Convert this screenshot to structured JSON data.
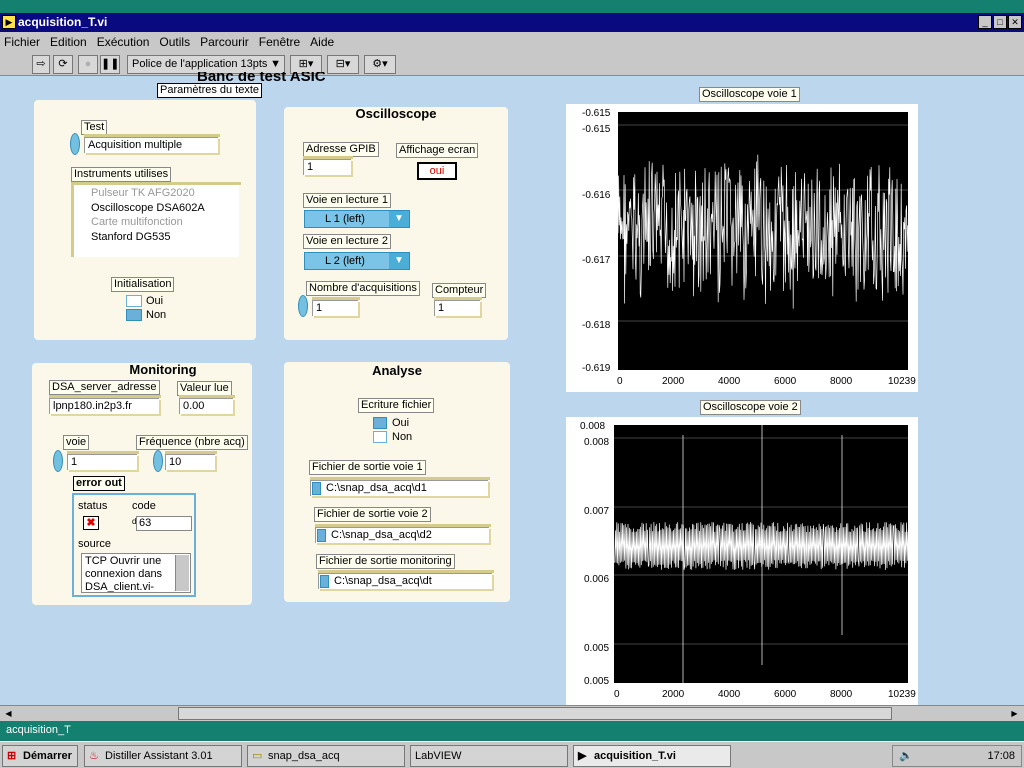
{
  "window": {
    "title": "acquisition_T.vi"
  },
  "menu": [
    "Fichier",
    "Edition",
    "Exécution",
    "Outils",
    "Parcourir",
    "Fenêtre",
    "Aide"
  ],
  "toolbar": {
    "font_label": "Police de l'application 13pts"
  },
  "header": {
    "overlap_title": "Banc de test ASIC",
    "font_tooltip": "Paramètres du texte"
  },
  "test_panel": {
    "test_label": "Test",
    "test_value": "Acquisition multiple",
    "instruments_label": "Instruments utilises",
    "instruments": [
      "Pulseur TK AFG2020",
      "Oscilloscope DSA602A",
      "Carte multifonction",
      "Stanford DG535"
    ],
    "init_label": "Initialisation",
    "init_oui": "Oui",
    "init_non": "Non"
  },
  "oscillo_panel": {
    "title": "Oscilloscope",
    "gpib_label": "Adresse GPIB",
    "gpib_value": "1",
    "affichage_label": "Affichage ecran",
    "affichage_value": "oui",
    "voie1_label": "Voie en lecture 1",
    "voie1_value": "L 1 (left)",
    "voie2_label": "Voie en lecture 2",
    "voie2_value": "L 2 (left)",
    "nb_acq_label": "Nombre d'acquisitions",
    "nb_acq_value": "1",
    "compteur_label": "Compteur",
    "compteur_value": "1"
  },
  "monitoring_panel": {
    "title": "Monitoring",
    "server_label": "DSA_server_adresse",
    "server_value": "lpnp180.in2p3.fr",
    "valeur_label": "Valeur lue",
    "valeur_value": "0.00",
    "voie_label": "voie",
    "voie_value": "1",
    "freq_label": "Fréquence (nbre acq)",
    "freq_value": "10",
    "error_label": "error out",
    "status_label": "status",
    "code_label": "code",
    "code_value": "63",
    "source_label": "source",
    "source_value": "TCP Ouvrir une connexion dans DSA_client.vi-"
  },
  "analyse_panel": {
    "title": "Analyse",
    "ecriture_label": "Ecriture fichier",
    "ecriture_oui": "Oui",
    "ecriture_non": "Non",
    "f1_label": "Fichier de sortie voie 1",
    "f1_value": "C:\\snap_dsa_acq\\d1",
    "f2_label": "Fichier de sortie voie 2",
    "f2_value": "C:\\snap_dsa_acq\\d2",
    "fm_label": "Fichier de sortie monitoring",
    "fm_value": "C:\\snap_dsa_acq\\dt"
  },
  "graph1": {
    "title": "Oscilloscope voie 1",
    "top_value": "-0.615",
    "y_ticks": [
      "-0.615",
      "-0.616",
      "-0.617",
      "-0.618",
      "-0.619"
    ],
    "x_ticks": [
      "0",
      "2000",
      "4000",
      "6000",
      "8000",
      "10239"
    ]
  },
  "graph2": {
    "title": "Oscilloscope voie 2",
    "top_value": "0.008",
    "y_ticks": [
      "0.008",
      "0.007",
      "0.006",
      "0.005",
      "0.005"
    ],
    "x_ticks": [
      "0",
      "2000",
      "4000",
      "6000",
      "8000",
      "10239"
    ]
  },
  "statusbar": {
    "text": "acquisition_T"
  },
  "taskbar": {
    "start": "Démarrer",
    "items": [
      "Distiller Assistant 3.01",
      "snap_dsa_acq",
      "LabVIEW",
      "acquisition_T.vi"
    ],
    "clock": "17:08"
  },
  "colors": {
    "panel": "#fbf8ea",
    "background": "#bcd6ee",
    "title_bar": "#0a0a80",
    "ring": "#7cc3e8"
  }
}
